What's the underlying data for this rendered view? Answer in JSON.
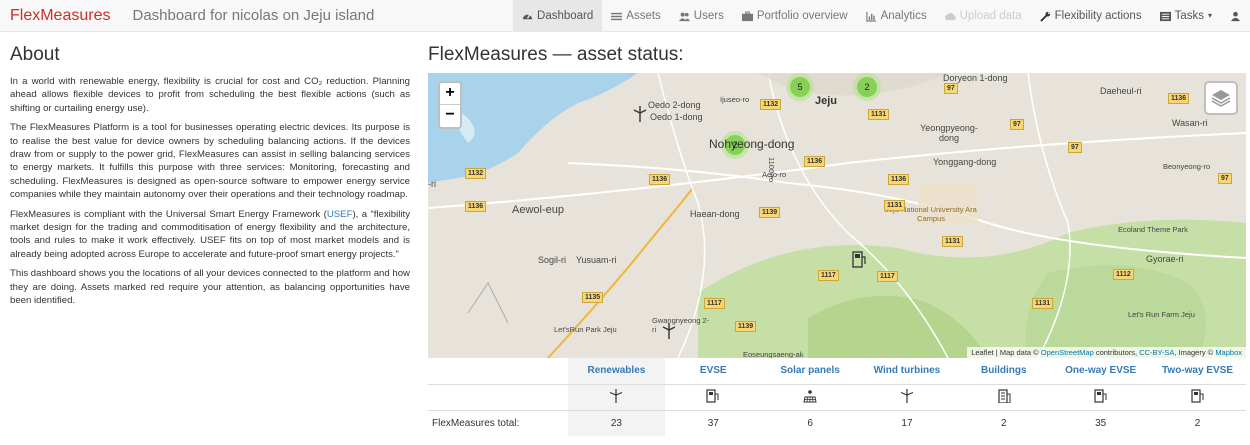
{
  "nav": {
    "brand": "FlexMeasures",
    "subtitle": "Dashboard for nicolas on Jeju island",
    "links": [
      {
        "label": "Dashboard",
        "icon": "dashboard-icon"
      },
      {
        "label": "Assets",
        "icon": "list-icon"
      },
      {
        "label": "Users",
        "icon": "users-icon"
      },
      {
        "label": "Portfolio overview",
        "icon": "portfolio-icon"
      },
      {
        "label": "Analytics",
        "icon": "chart-icon"
      },
      {
        "label": "Upload data",
        "icon": "cloud-upload-icon"
      },
      {
        "label": "Flexibility actions",
        "icon": "wrench-icon"
      },
      {
        "label": "Tasks",
        "icon": "tasks-icon"
      }
    ]
  },
  "about": {
    "title": "About",
    "p1": "In a world with renewable energy, flexibility is crucial for cost and CO₂ reduction. Planning ahead allows flexible devices to profit from scheduling the best flexible actions (such as shifting or curtailing energy use).",
    "p2": "The FlexMeasures Platform is a tool for businesses operating electric devices. Its purpose is to realise the best value for device owners by scheduling balancing actions. If the devices draw from or supply to the power grid, FlexMeasures can assist in selling balancing services to energy markets. It fulfills this purpose with three services: Monitoring, forecasting and scheduling. FlexMeasures is designed as open-source software to empower energy service companies while they maintain autonomy over their operations and their technology roadmap.",
    "p3_pre": "FlexMeasures is compliant with the Universal Smart Energy Framework (",
    "p3_link": "USEF",
    "p3_post": "), a “flexibility market design for the trading and commoditisation of energy flexibility and the architecture, tools and rules to make it work effectively. USEF fits on top of most market models and is already being adopted across Europe to accelerate and future-proof smart energy projects.”",
    "p4": "This dashboard shows you the locations of all your devices connected to the platform and how they are doing. Assets marked red require your attention, as balancing opportunities have been identified."
  },
  "status": {
    "title": "FlexMeasures — asset status:"
  },
  "map": {
    "zoom_in": "+",
    "zoom_out": "−",
    "clusters": [
      "5",
      "2",
      "2"
    ],
    "places": [
      "Oedo 2-dong",
      "Oedo 1-dong",
      "Ijuseo-ro",
      "Jeju",
      "Nohyeong-dong",
      "Yeongpyeong-dong",
      "Yonggang-dong",
      "Aewol-eup",
      "Haean-dong",
      "Aejo-ro",
      "Jeju National University Ara Campus",
      "Sogil-ri",
      "Yusuam-ri",
      "Ecoland Theme Park",
      "Gyorae-ri",
      "Let'sRun Park Jeju",
      "Gwangnyeong 2-ri",
      "Let's Run Farm Jeju",
      "Wasan-ri",
      "Daeheul-ri",
      "Eoseungsaeng-ak",
      "Doryeon 1-dong",
      "-ri",
      "Beonyeong-ro",
      "1100-ro"
    ],
    "roads": [
      "1132",
      "1132",
      "1131",
      "97",
      "97",
      "97",
      "1136",
      "1136",
      "1136",
      "1136",
      "1136",
      "1131",
      "1139",
      "1131",
      "1117",
      "1117",
      "1117",
      "1139",
      "1135",
      "1112",
      "1131",
      "97"
    ],
    "attribution_pre": "Leaflet | Map data © ",
    "attribution_osm": "OpenStreetMap",
    "attribution_mid": " contributors, ",
    "attribution_cc": "CC-BY-SA",
    "attribution_mid2": ", Imagery © ",
    "attribution_mb": "Mapbox"
  },
  "table": {
    "columns": [
      "Renewables",
      "EVSE",
      "Solar panels",
      "Wind turbines",
      "Buildings",
      "One-way EVSE",
      "Two-way EVSE"
    ],
    "icons": [
      "wind-turbine-icon",
      "ev-charger-icon",
      "solar-panel-icon",
      "wind-turbine-icon",
      "building-icon",
      "ev-charger-icon",
      "ev-charger-icon"
    ],
    "row_label": "FlexMeasures total:",
    "totals": [
      "23",
      "37",
      "6",
      "17",
      "2",
      "35",
      "2"
    ]
  }
}
